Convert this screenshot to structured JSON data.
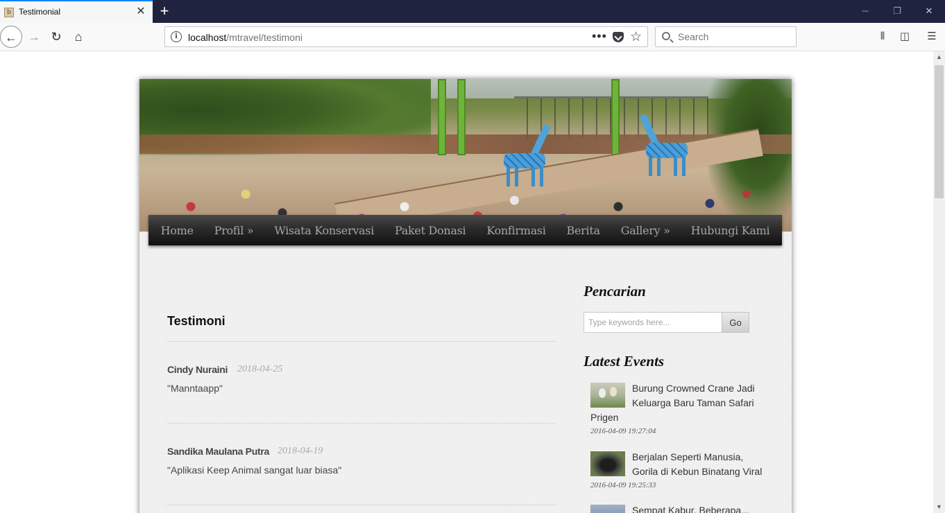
{
  "browser": {
    "tab_title": "Testimonial",
    "favicon_letter": "b",
    "tab_close": "✕",
    "new_tab": "+",
    "url_host": "localhost",
    "url_path": "/mtravel/testimoni",
    "url_more": "•••",
    "search_placeholder": "Search",
    "window_controls": {
      "minimize": "─",
      "restore": "❐",
      "close": "✕"
    }
  },
  "menu": {
    "items": [
      {
        "label": "Home"
      },
      {
        "label": "Profil »"
      },
      {
        "label": "Wisata Konservasi"
      },
      {
        "label": "Paket Donasi"
      },
      {
        "label": "Konfirmasi"
      },
      {
        "label": "Berita"
      },
      {
        "label": "Gallery »"
      },
      {
        "label": "Hubungi Kami"
      }
    ]
  },
  "main": {
    "title": "Testimoni",
    "testimonials": [
      {
        "name": "Cindy Nuraini",
        "date": "2018-04-25",
        "text": "\"Manntaapp\""
      },
      {
        "name": "Sandika Maulana Putra",
        "date": "2018-04-19",
        "text": "\"Aplikasi Keep Animal sangat luar biasa\""
      }
    ]
  },
  "sidebar": {
    "search_heading": "Pencarian",
    "search_placeholder": "Type keywords here...",
    "search_button": "Go",
    "events_heading": "Latest Events",
    "events": [
      {
        "title": "Burung Crowned Crane Jadi Keluarga Baru Taman Safari Prigen",
        "date": "2016-04-09 19:27:04",
        "thumb": "crane-photo"
      },
      {
        "title": "Berjalan Seperti Manusia, Gorila di Kebun Binatang Viral",
        "date": "2016-04-09 19:25:33",
        "thumb": "gorilla-photo"
      },
      {
        "title": "Sempat Kabur, Beberapa...",
        "date": "",
        "thumb": "event-photo"
      }
    ]
  }
}
